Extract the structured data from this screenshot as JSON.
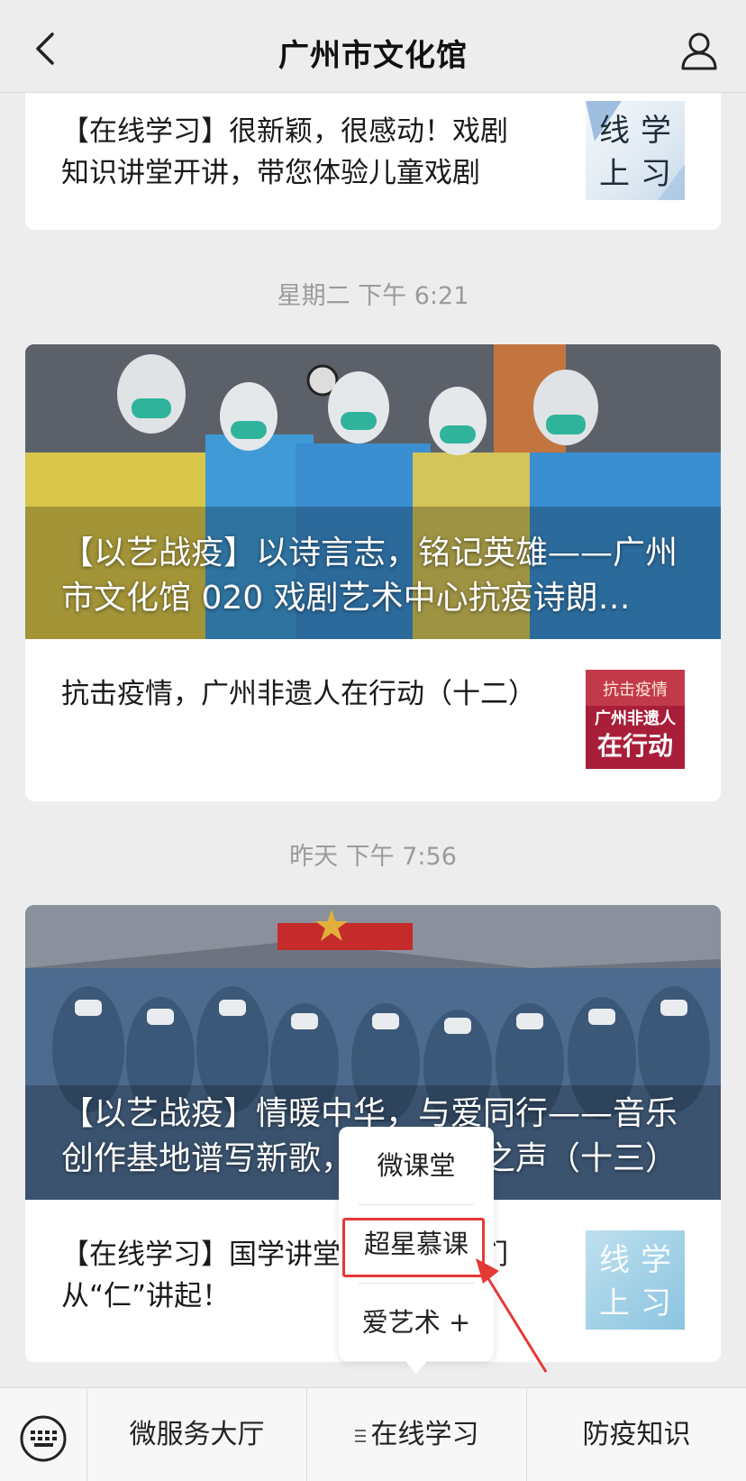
{
  "navbar": {
    "title": "广州市文化馆"
  },
  "cards": [
    {
      "text": "【在线学习】很新颖，很感动！戏剧知识讲堂开讲，带您体验儿童戏剧魅…",
      "thumb_text": [
        "线",
        "学",
        "上",
        "习"
      ]
    },
    {
      "hero_text": "【以艺战疫】以诗言志，铭记英雄——广州市文化馆 020 戏剧艺术中心抗疫诗朗…",
      "row_text": "抗击疫情，广州非遗人在行动（十二）",
      "thumb_lines": [
        "抗击疫情",
        "广州非遗人",
        "在行动"
      ]
    },
    {
      "hero_text": "【以艺战疫】情暖中华，与爱同行——音乐创作基地谱写新歌，唱响时代之声（十三）",
      "row_text": "【在线学习】国学讲堂第二辑，我们从“仁”讲起！",
      "thumb_text": [
        "线",
        "学",
        "上",
        "习"
      ]
    }
  ],
  "timestamps": [
    "星期二 下午 6:21",
    "昨天 下午 7:56"
  ],
  "tabbar": {
    "tabs": [
      "微服务大厅",
      "在线学习",
      "防疫知识"
    ]
  },
  "popup": {
    "items": [
      "微课堂",
      "超星慕课",
      "爱艺术 +"
    ]
  },
  "colors": {
    "highlight": "#e53935",
    "background": "#ededed"
  }
}
